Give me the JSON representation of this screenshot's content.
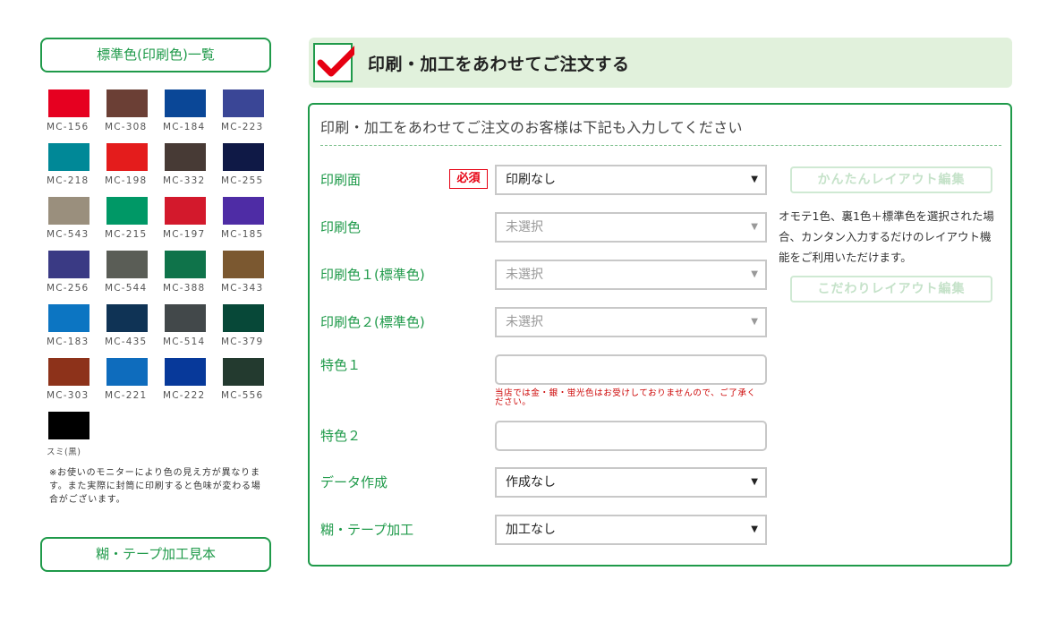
{
  "sidebar": {
    "standard_colors_button": "標準色(印刷色)一覧",
    "swatches": [
      {
        "code": "MC-156",
        "color": "#e60020"
      },
      {
        "code": "MC-308",
        "color": "#6b3f35"
      },
      {
        "code": "MC-184",
        "color": "#0a4797"
      },
      {
        "code": "MC-223",
        "color": "#3a4696"
      },
      {
        "code": "MC-218",
        "color": "#008897"
      },
      {
        "code": "MC-198",
        "color": "#e41c1c"
      },
      {
        "code": "MC-332",
        "color": "#473a35"
      },
      {
        "code": "MC-255",
        "color": "#0f1946"
      },
      {
        "code": "MC-543",
        "color": "#9a8f7d"
      },
      {
        "code": "MC-215",
        "color": "#009866"
      },
      {
        "code": "MC-197",
        "color": "#d3192c"
      },
      {
        "code": "MC-185",
        "color": "#4e2ca5"
      },
      {
        "code": "MC-256",
        "color": "#3a3a84"
      },
      {
        "code": "MC-544",
        "color": "#5a5d56"
      },
      {
        "code": "MC-388",
        "color": "#0f734a"
      },
      {
        "code": "MC-343",
        "color": "#7b5830"
      },
      {
        "code": "MC-183",
        "color": "#0c75c2"
      },
      {
        "code": "MC-435",
        "color": "#0f3355"
      },
      {
        "code": "MC-514",
        "color": "#42484a"
      },
      {
        "code": "MC-379",
        "color": "#074838"
      },
      {
        "code": "MC-303",
        "color": "#8d321a"
      },
      {
        "code": "MC-221",
        "color": "#0e6cbd"
      },
      {
        "code": "MC-222",
        "color": "#07399a"
      },
      {
        "code": "MC-556",
        "color": "#233a2f"
      },
      {
        "code": "スミ(黒)",
        "color": "#000000"
      }
    ],
    "note": "※お使いのモニターにより色の見え方が異なります。また実際に封筒に印刷すると色味が変わる場合がございます。",
    "glue_tape_button": "糊・テープ加工見本"
  },
  "header": {
    "title": "印刷・加工をあわせてご注文する"
  },
  "form": {
    "heading": "印刷・加工をあわせてご注文のお客様は下記も入力してください",
    "required_badge": "必須",
    "print_side": {
      "label": "印刷面",
      "value": "印刷なし"
    },
    "print_color": {
      "label": "印刷色",
      "value": "未選択"
    },
    "print_color1": {
      "label": "印刷色１(標準色)",
      "value": "未選択"
    },
    "print_color2": {
      "label": "印刷色２(標準色)",
      "value": "未選択"
    },
    "special_color1": {
      "label": "特色１",
      "value": ""
    },
    "special_color1_warning": "当店では金・銀・蛍光色はお受けしておりませんので、ご了承ください。",
    "special_color2": {
      "label": "特色２",
      "value": ""
    },
    "data_creation": {
      "label": "データ作成",
      "value": "作成なし"
    },
    "glue_tape": {
      "label": "糊・テープ加工",
      "value": "加工なし"
    },
    "easy_layout_button": "かんたんレイアウト編集",
    "layout_description": "オモテ1色、裏1色＋標準色を選択された場合、カンタン入力するだけのレイアウト機能をご利用いただけます。",
    "custom_layout_button": "こだわりレイアウト編集"
  },
  "colors": {
    "accent_green": "#1f9a4a",
    "title_bg": "#e1f1dc",
    "required_red": "#e60012"
  }
}
